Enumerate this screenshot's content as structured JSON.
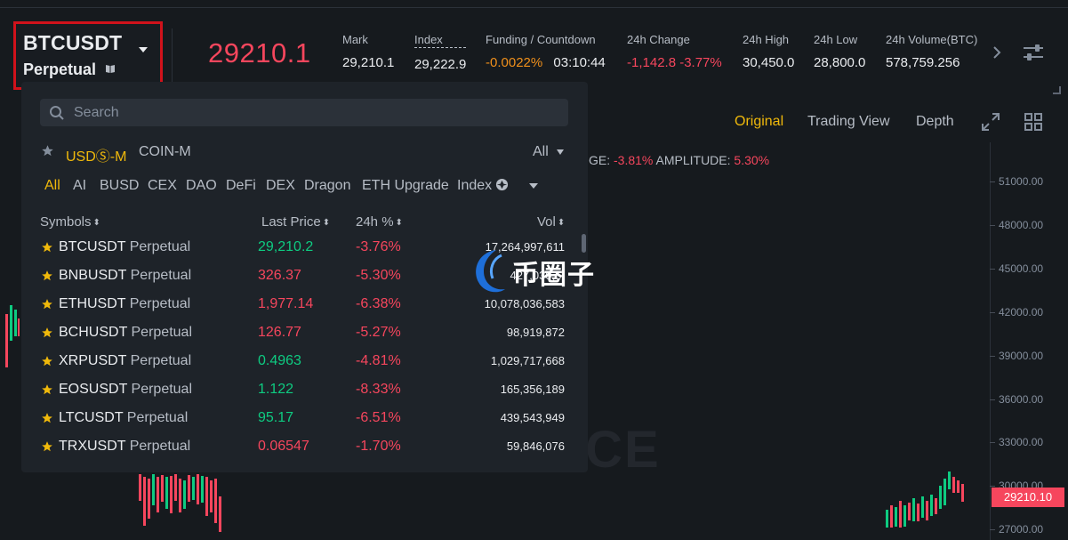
{
  "symbol": {
    "name": "BTCUSDT",
    "type": "Perpetual"
  },
  "last_price": "29210.1",
  "stats": {
    "mark": {
      "label": "Mark",
      "value": "29,210.1"
    },
    "index": {
      "label": "Index",
      "value": "29,222.9"
    },
    "funding": {
      "label": "Funding / Countdown",
      "rate": "-0.0022%",
      "countdown": "03:10:44"
    },
    "change_24h": {
      "label": "24h Change",
      "value": "-1,142.8 -3.77%"
    },
    "high_24h": {
      "label": "24h High",
      "value": "30,450.0"
    },
    "low_24h": {
      "label": "24h Low",
      "value": "28,800.0"
    },
    "volume_24h": {
      "label": "24h Volume(BTC)",
      "value": "578,759.256"
    }
  },
  "chart_tabs": [
    "Original",
    "Trading View",
    "Depth"
  ],
  "change_line": {
    "change_label": "GE:",
    "change_value": "-3.81%",
    "amplitude_label": "AMPLITUDE:",
    "amplitude_value": "5.30%"
  },
  "price_axis": [
    "51000.00",
    "48000.00",
    "45000.00",
    "42000.00",
    "39000.00",
    "36000.00",
    "33000.00",
    "30000.00",
    "27000.00"
  ],
  "current_price_tag": "29210.10",
  "watermark": "ICE",
  "dropdown": {
    "search_placeholder": "Search",
    "markets": {
      "usd_m": "USDⓈ-M",
      "coin_m": "COIN-M"
    },
    "filter": "All",
    "categories": [
      "All",
      "AI",
      "BUSD",
      "CEX",
      "DAO",
      "DeFi",
      "DEX",
      "Dragon",
      "ETH Upgrade",
      "Index"
    ],
    "columns": {
      "symbol": "Symbols",
      "last_price": "Last Price",
      "change": "24h %",
      "volume": "Vol"
    },
    "rows": [
      {
        "symbol": "BTCUSDT",
        "type": "Perpetual",
        "price": "29,210.2",
        "price_dir": "up",
        "change": "-3.76%",
        "volume": "17,264,997,611"
      },
      {
        "symbol": "BNBUSDT",
        "type": "Perpetual",
        "price": "326.37",
        "price_dir": "down",
        "change": "-5.30%",
        "volume": "427,030,..."
      },
      {
        "symbol": "ETHUSDT",
        "type": "Perpetual",
        "price": "1,977.14",
        "price_dir": "down",
        "change": "-6.38%",
        "volume": "10,078,036,583"
      },
      {
        "symbol": "BCHUSDT",
        "type": "Perpetual",
        "price": "126.77",
        "price_dir": "down",
        "change": "-5.27%",
        "volume": "98,919,872"
      },
      {
        "symbol": "XRPUSDT",
        "type": "Perpetual",
        "price": "0.4963",
        "price_dir": "up",
        "change": "-4.81%",
        "volume": "1,029,717,668"
      },
      {
        "symbol": "EOSUSDT",
        "type": "Perpetual",
        "price": "1.122",
        "price_dir": "up",
        "change": "-8.33%",
        "volume": "165,356,189"
      },
      {
        "symbol": "LTCUSDT",
        "type": "Perpetual",
        "price": "95.17",
        "price_dir": "up",
        "change": "-6.51%",
        "volume": "439,543,949"
      },
      {
        "symbol": "TRXUSDT",
        "type": "Perpetual",
        "price": "0.06547",
        "price_dir": "down",
        "change": "-1.70%",
        "volume": "59,846,076"
      }
    ]
  },
  "logo_watermark": "币圈子",
  "colors": {
    "up": "#0ecb81",
    "down": "#f6465d",
    "accent": "#f0b90b",
    "highlight_border": "#d0121b"
  },
  "icons": [
    "book-icon",
    "caret-down-icon",
    "chevron-right-icon",
    "settings-sliders-icon",
    "expand-icon",
    "grid-layout-icon",
    "search-icon",
    "star-icon",
    "index-info-icon"
  ]
}
